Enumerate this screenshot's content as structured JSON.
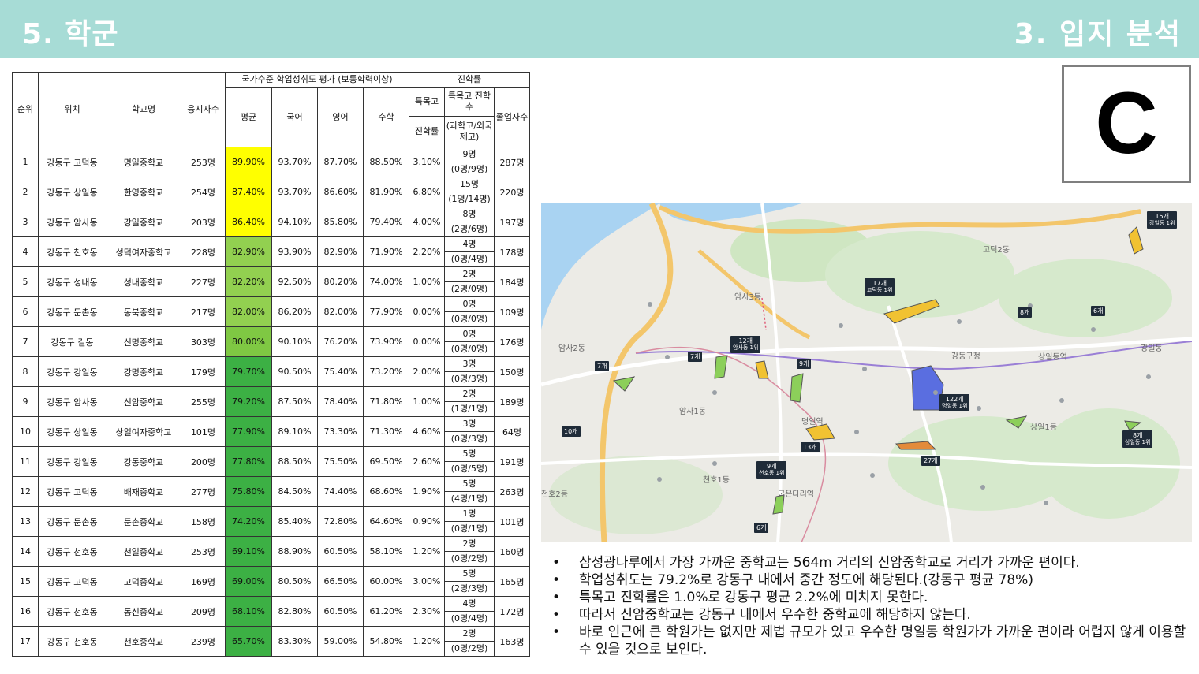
{
  "header": {
    "left_title": "5. 학군",
    "right_title": "3. 입지 분석"
  },
  "grade": "C",
  "table": {
    "headers": {
      "rank": "순위",
      "location": "위치",
      "school": "학교명",
      "examinees": "응시자수",
      "national_group": "국가수준 학업성취도 평가 (보통학력이상)",
      "avg": "평균",
      "korean": "국어",
      "english": "영어",
      "math": "수학",
      "advancement_group": "진학률",
      "special_rate_1": "특목고",
      "special_rate_2": "진학률",
      "special_count_1": "특목고 진학수",
      "special_count_2": "(과학고/외국제고)",
      "graduates": "졸업자수"
    },
    "rows": [
      {
        "rank": "1",
        "location": "강동구 고덕동",
        "school": "명일중학교",
        "examinees": "253명",
        "avg": "89.90%",
        "avg_color": "#ffff00",
        "korean": "93.70%",
        "english": "87.70%",
        "math": "88.50%",
        "special_rate": "3.10%",
        "adm_count": "9명",
        "adm_detail": "(0명/9명)",
        "graduates": "287명"
      },
      {
        "rank": "2",
        "location": "강동구 상일동",
        "school": "한영중학교",
        "examinees": "254명",
        "avg": "87.40%",
        "avg_color": "#ffff00",
        "korean": "93.70%",
        "english": "86.60%",
        "math": "81.90%",
        "special_rate": "6.80%",
        "adm_count": "15명",
        "adm_detail": "(1명/14명)",
        "graduates": "220명"
      },
      {
        "rank": "3",
        "location": "강동구 암사동",
        "school": "강일중학교",
        "examinees": "203명",
        "avg": "86.40%",
        "avg_color": "#ffff00",
        "korean": "94.10%",
        "english": "85.80%",
        "math": "79.40%",
        "special_rate": "4.00%",
        "adm_count": "8명",
        "adm_detail": "(2명/6명)",
        "graduates": "197명"
      },
      {
        "rank": "4",
        "location": "강동구 천호동",
        "school": "성덕여자중학교",
        "examinees": "228명",
        "avg": "82.90%",
        "avg_color": "#92d050",
        "korean": "93.90%",
        "english": "82.90%",
        "math": "71.90%",
        "special_rate": "2.20%",
        "adm_count": "4명",
        "adm_detail": "(0명/4명)",
        "graduates": "178명"
      },
      {
        "rank": "5",
        "location": "강동구 성내동",
        "school": "성내중학교",
        "examinees": "227명",
        "avg": "82.20%",
        "avg_color": "#92d050",
        "korean": "92.50%",
        "english": "80.20%",
        "math": "74.00%",
        "special_rate": "1.00%",
        "adm_count": "2명",
        "adm_detail": "(2명/0명)",
        "graduates": "184명"
      },
      {
        "rank": "6",
        "location": "강동구 둔촌동",
        "school": "동북중학교",
        "examinees": "217명",
        "avg": "82.00%",
        "avg_color": "#92d050",
        "korean": "86.20%",
        "english": "82.00%",
        "math": "77.90%",
        "special_rate": "0.00%",
        "adm_count": "0명",
        "adm_detail": "(0명/0명)",
        "graduates": "109명"
      },
      {
        "rank": "7",
        "location": "강동구 길동",
        "school": "신명중학교",
        "examinees": "303명",
        "avg": "80.00%",
        "avg_color": "#7fc843",
        "korean": "90.10%",
        "english": "76.20%",
        "math": "73.90%",
        "special_rate": "0.00%",
        "adm_count": "0명",
        "adm_detail": "(0명/0명)",
        "graduates": "176명"
      },
      {
        "rank": "8",
        "location": "강동구 강일동",
        "school": "강명중학교",
        "examinees": "179명",
        "avg": "79.70%",
        "avg_color": "#3cb044",
        "korean": "90.50%",
        "english": "75.40%",
        "math": "73.20%",
        "special_rate": "2.00%",
        "adm_count": "3명",
        "adm_detail": "(0명/3명)",
        "graduates": "150명"
      },
      {
        "rank": "9",
        "location": "강동구 암사동",
        "school": "신암중학교",
        "examinees": "255명",
        "avg": "79.20%",
        "avg_color": "#3cb044",
        "korean": "87.50%",
        "english": "78.40%",
        "math": "71.80%",
        "special_rate": "1.00%",
        "adm_count": "2명",
        "adm_detail": "(1명/1명)",
        "graduates": "189명"
      },
      {
        "rank": "10",
        "location": "강동구 상일동",
        "school": "상일여자중학교",
        "examinees": "101명",
        "avg": "77.90%",
        "avg_color": "#3cb044",
        "korean": "89.10%",
        "english": "73.30%",
        "math": "71.30%",
        "special_rate": "4.60%",
        "adm_count": "3명",
        "adm_detail": "(0명/3명)",
        "graduates": "64명"
      },
      {
        "rank": "11",
        "location": "강동구 강일동",
        "school": "강동중학교",
        "examinees": "200명",
        "avg": "77.80%",
        "avg_color": "#3cb044",
        "korean": "88.50%",
        "english": "75.50%",
        "math": "69.50%",
        "special_rate": "2.60%",
        "adm_count": "5명",
        "adm_detail": "(0명/5명)",
        "graduates": "191명"
      },
      {
        "rank": "12",
        "location": "강동구 고덕동",
        "school": "배재중학교",
        "examinees": "277명",
        "avg": "75.80%",
        "avg_color": "#3cb044",
        "korean": "84.50%",
        "english": "74.40%",
        "math": "68.60%",
        "special_rate": "1.90%",
        "adm_count": "5명",
        "adm_detail": "(4명/1명)",
        "graduates": "263명"
      },
      {
        "rank": "13",
        "location": "강동구 둔촌동",
        "school": "둔촌중학교",
        "examinees": "158명",
        "avg": "74.20%",
        "avg_color": "#3cb044",
        "korean": "85.40%",
        "english": "72.80%",
        "math": "64.60%",
        "special_rate": "0.90%",
        "adm_count": "1명",
        "adm_detail": "(0명/1명)",
        "graduates": "101명"
      },
      {
        "rank": "14",
        "location": "강동구 천호동",
        "school": "천일중학교",
        "examinees": "253명",
        "avg": "69.10%",
        "avg_color": "#3cb044",
        "korean": "88.90%",
        "english": "60.50%",
        "math": "58.10%",
        "special_rate": "1.20%",
        "adm_count": "2명",
        "adm_detail": "(0명/2명)",
        "graduates": "160명"
      },
      {
        "rank": "15",
        "location": "강동구 고덕동",
        "school": "고덕중학교",
        "examinees": "169명",
        "avg": "69.00%",
        "avg_color": "#3cb044",
        "korean": "80.50%",
        "english": "66.50%",
        "math": "60.00%",
        "special_rate": "3.00%",
        "adm_count": "5명",
        "adm_detail": "(2명/3명)",
        "graduates": "165명"
      },
      {
        "rank": "16",
        "location": "강동구 천호동",
        "school": "동신중학교",
        "examinees": "209명",
        "avg": "68.10%",
        "avg_color": "#3cb044",
        "korean": "82.80%",
        "english": "60.50%",
        "math": "61.20%",
        "special_rate": "2.30%",
        "adm_count": "4명",
        "adm_detail": "(0명/4명)",
        "graduates": "172명"
      },
      {
        "rank": "17",
        "location": "강동구 천호동",
        "school": "천호중학교",
        "examinees": "239명",
        "avg": "65.70%",
        "avg_color": "#3cb044",
        "korean": "83.30%",
        "english": "59.00%",
        "math": "54.80%",
        "special_rate": "1.20%",
        "adm_count": "2명",
        "adm_detail": "(0명/2명)",
        "graduates": "163명"
      }
    ]
  },
  "map": {
    "place_names": [
      "암사3동",
      "암사2동",
      "암사1동",
      "상일1동",
      "천호2동",
      "천호1동",
      "고덕2동",
      "강일동",
      "명일역",
      "굽은다리역",
      "강동구청",
      "상일동역"
    ],
    "markers": [
      {
        "label": "15개",
        "sub": "강일동 1위"
      },
      {
        "label": "17개",
        "sub": "고덕동 1위"
      },
      {
        "label": "12개",
        "sub": "암사동 1위"
      },
      {
        "label": "8개",
        "sub": ""
      },
      {
        "label": "6개",
        "sub": ""
      },
      {
        "label": "7개",
        "sub": ""
      },
      {
        "label": "7개",
        "sub": ""
      },
      {
        "label": "9개",
        "sub": ""
      },
      {
        "label": "122개",
        "sub": "명일동 1위"
      },
      {
        "label": "10개",
        "sub": ""
      },
      {
        "label": "13개",
        "sub": ""
      },
      {
        "label": "27개",
        "sub": ""
      },
      {
        "label": "9개",
        "sub": "천호동 1위"
      },
      {
        "label": "8개",
        "sub": "상일동 1위"
      },
      {
        "label": "6개",
        "sub": ""
      }
    ]
  },
  "bullets": [
    "삼성광나루에서 가장 가까운 중학교는 564m 거리의 신암중학교로 거리가 가까운 편이다.",
    "학업성취도는 79.2%로 강동구 내에서 중간 정도에 해당된다.(강동구 평균 78%)",
    "특목고 진학률은 1.0%로 강동구 평균 2.2%에 미치지 못한다.",
    "따라서 신암중학교는 강동구 내에서 우수한 중학교에 해당하지 않는다.",
    "바로 인근에 큰 학원가는 없지만 제법 규모가 있고 우수한 명일동 학원가가 가까운 편이라 어렵지 않게 이용할 수 있을 것으로 보인다."
  ]
}
